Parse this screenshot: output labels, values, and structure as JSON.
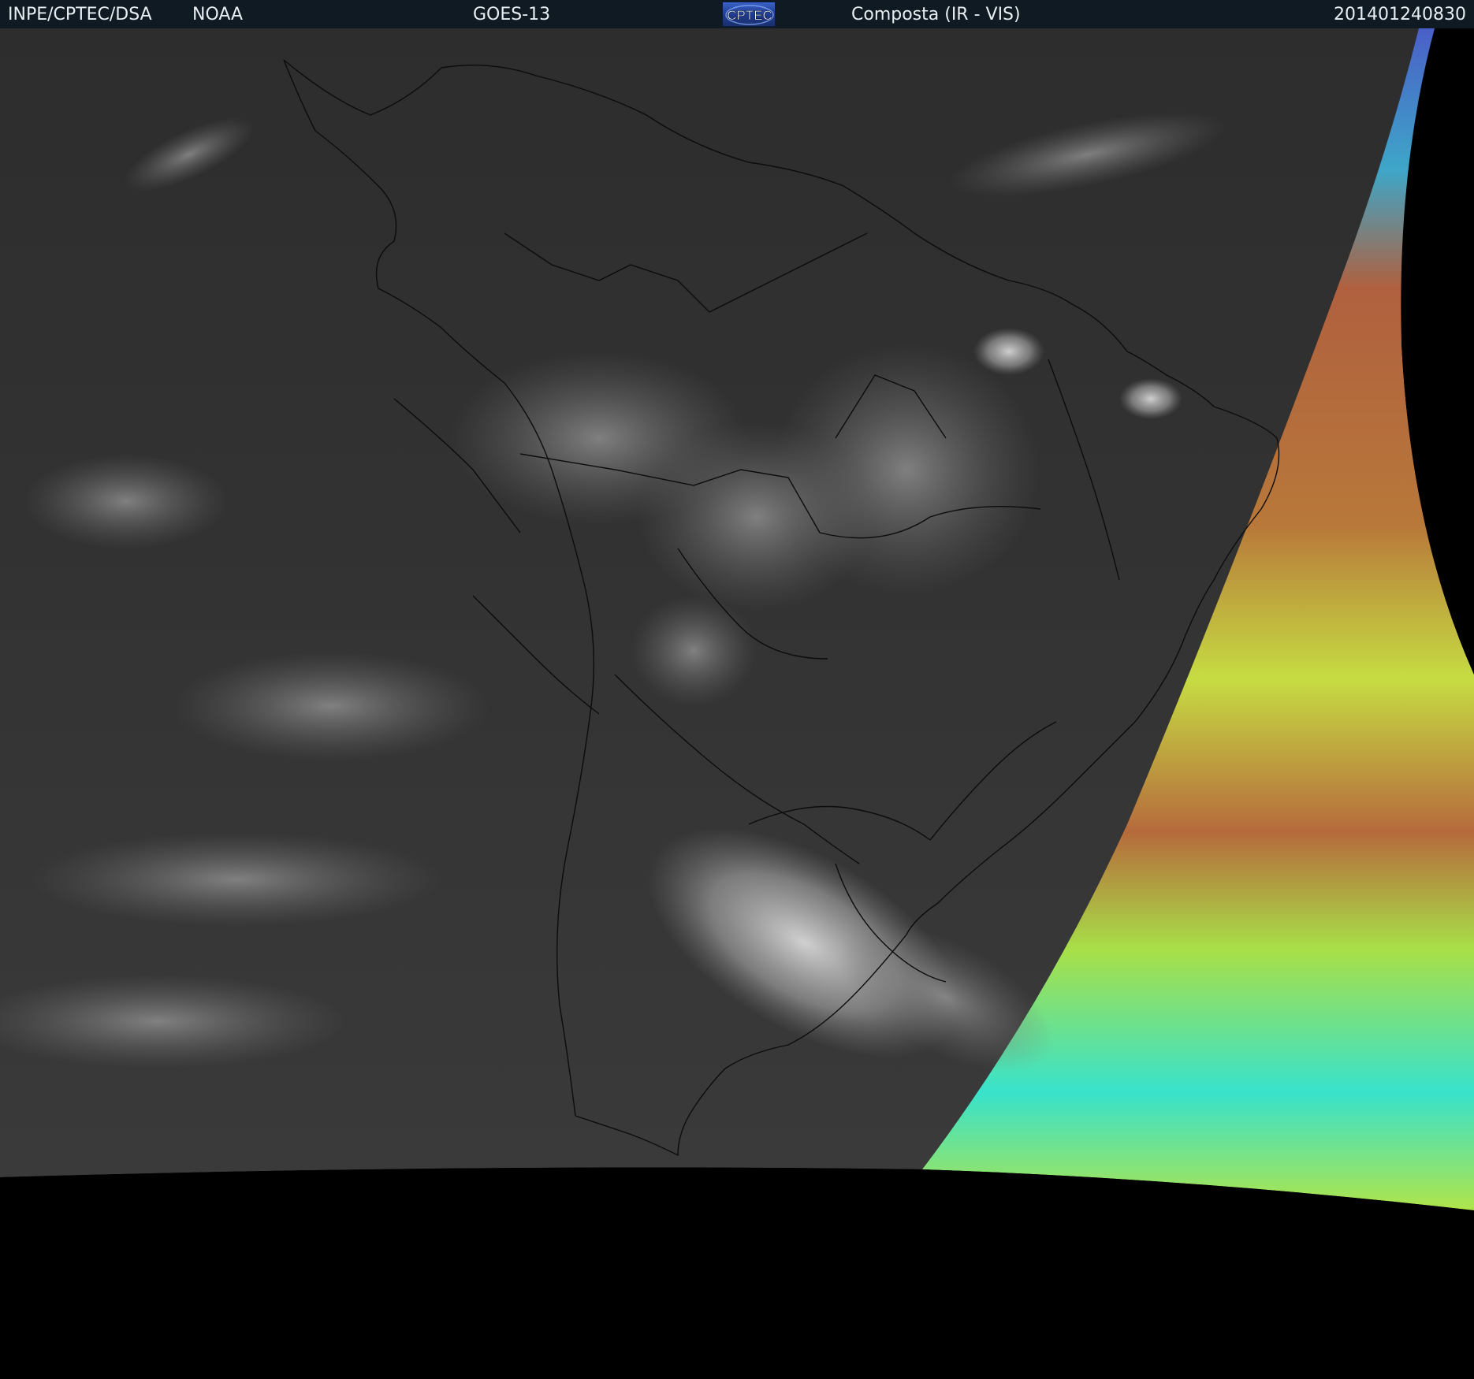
{
  "header": {
    "organization": "INPE/CPTEC/DSA",
    "agency": "NOAA",
    "satellite": "GOES-13",
    "logo_text": "CPTEC",
    "product": "Composta (IR - VIS)",
    "timestamp": "201401240830"
  },
  "colors": {
    "header_bg": "#101a22",
    "header_text": "#e6eef2",
    "ir_background": "#2e2e2e",
    "space": "#000000",
    "vis_red": "#b05a3a",
    "vis_yellow": "#c8e040",
    "vis_cyan": "#30e0d0",
    "vis_blue": "#4060c0"
  }
}
